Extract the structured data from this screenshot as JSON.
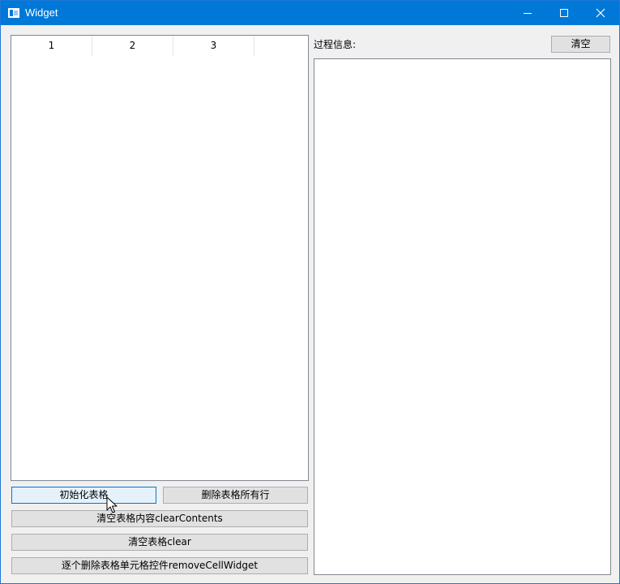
{
  "window": {
    "title": "Widget",
    "icon": "app-window-icon",
    "controls": [
      "minimize-icon",
      "maximize-icon",
      "close-icon"
    ],
    "accent_color": "#0078d7"
  },
  "table": {
    "headers": [
      "1",
      "2",
      "3",
      ""
    ],
    "rows": []
  },
  "buttons": {
    "init": "初始化表格",
    "delete_rows": "删除表格所有行",
    "clear_contents": "清空表格内容clearContents",
    "clear": "清空表格clear",
    "remove_cell_widget": "逐个删除表格单元格控件removeCellWidget"
  },
  "log": {
    "label": "过程信息:",
    "clear_button": "清空",
    "content": ""
  },
  "cursor": {
    "icon": "mouse-pointer-icon",
    "hovered": "init"
  }
}
